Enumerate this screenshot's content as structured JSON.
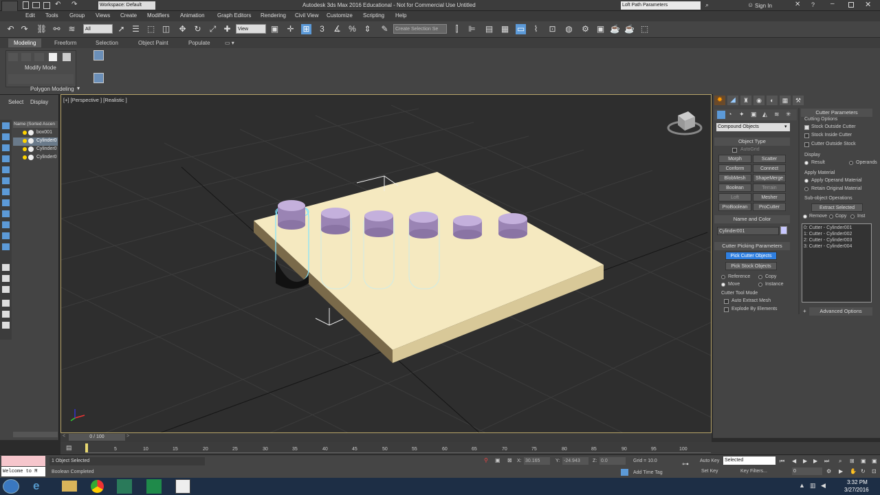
{
  "app": {
    "title": "Autodesk 3ds Max 2016 Educational  -  Not for Commercial Use    Untitled",
    "workspace": "Workspace: Default",
    "search_value": "Loft Path Parameters",
    "sign_in": "Sign In"
  },
  "menu": [
    "Edit",
    "Tools",
    "Group",
    "Views",
    "Create",
    "Modifiers",
    "Animation",
    "Graph Editors",
    "Rendering",
    "Civil View",
    "Customize",
    "Scripting",
    "Help"
  ],
  "toolbar": {
    "filter_value": "All",
    "view_value": "View",
    "selection_set_placeholder": "Create Selection Se"
  },
  "ribbon": {
    "tabs": [
      "Modeling",
      "Freeform",
      "Selection",
      "Object Paint",
      "Populate"
    ],
    "modify_mode": "Modify Mode",
    "polygon_modeling": "Polygon Modeling"
  },
  "explorer": {
    "tabs": [
      "Select",
      "Display"
    ],
    "column_header": "Name (Sorted Ascen",
    "items": [
      "box001",
      "Cylinder0",
      "Cylinder0",
      "Cylinder0"
    ]
  },
  "viewport": {
    "label": "[+] [Perspective ] [Realistic ]"
  },
  "create_panel": {
    "category": "Compound Objects",
    "object_type_title": "Object Type",
    "autogrid": "AutoGrid",
    "buttons": [
      "Morph",
      "Scatter",
      "Conform",
      "Connect",
      "BlobMesh",
      "ShapeMerge",
      "Boolean",
      "Terrain",
      "Loft",
      "Mesher",
      "ProBoolean",
      "ProCutter"
    ],
    "name_color_title": "Name and Color",
    "object_name": "Cylinder001",
    "object_color": "#c8c8ff",
    "cutter_picking_title": "Cutter Picking Parameters",
    "pick_cutter": "Pick Cutter Objects",
    "pick_stock": "Pick Stock Objects",
    "reference": "Reference",
    "copy": "Copy",
    "move": "Move",
    "instance": "Instance",
    "cutter_tool_mode": "Cutter Tool Mode",
    "auto_extract": "Auto Extract Mesh",
    "explode": "Explode By Elements"
  },
  "cutter_params": {
    "title": "Cutter Parameters",
    "cutting_options": "Cutting Options",
    "stock_outside": "Stock Outside Cutter",
    "stock_inside": "Stock Inside Cutter",
    "cutter_outside": "Cutter Outside Stock",
    "display": "Display",
    "result": "Result",
    "operands": "Operands",
    "apply_material": "Apply Material",
    "apply_operand_material": "Apply Operand Material",
    "retain_original_material": "Retain Original Material",
    "subobject_ops": "Sub-object Operations",
    "extract_selected": "Extract Selected",
    "remove": "Remove",
    "copy": "Copy",
    "inst": "Inst",
    "list": [
      "0: Cutter - Cylinder001",
      "1: Cutter - Cylinder002",
      "2: Cutter - Cylinder003",
      "3: Cutter - Cylinder004"
    ],
    "advanced": "Advanced Options"
  },
  "timeline": {
    "frame": "0 / 100",
    "ticks": [
      "5",
      "10",
      "15",
      "20",
      "25",
      "30",
      "35",
      "40",
      "45",
      "50",
      "55",
      "60",
      "65",
      "70",
      "75",
      "80",
      "85",
      "90",
      "95",
      "100"
    ]
  },
  "status": {
    "maxscript": "Welcome to M",
    "selected": "1 Object Selected",
    "prompt": "Boolean Completed",
    "x_label": "X:",
    "x_value": "30.165",
    "y_label": "Y:",
    "y_value": "-24.943",
    "z_label": "Z:",
    "z_value": "0.0",
    "grid": "Grid = 10.0",
    "add_time_tag": "Add Time Tag",
    "auto_key": "Auto Key",
    "set_key": "Set Key",
    "key_mode": "Selected",
    "key_filters": "Key Filters...",
    "frame_value": "0"
  },
  "taskbar": {
    "time": "3:32 PM",
    "date": "3/27/2016"
  }
}
